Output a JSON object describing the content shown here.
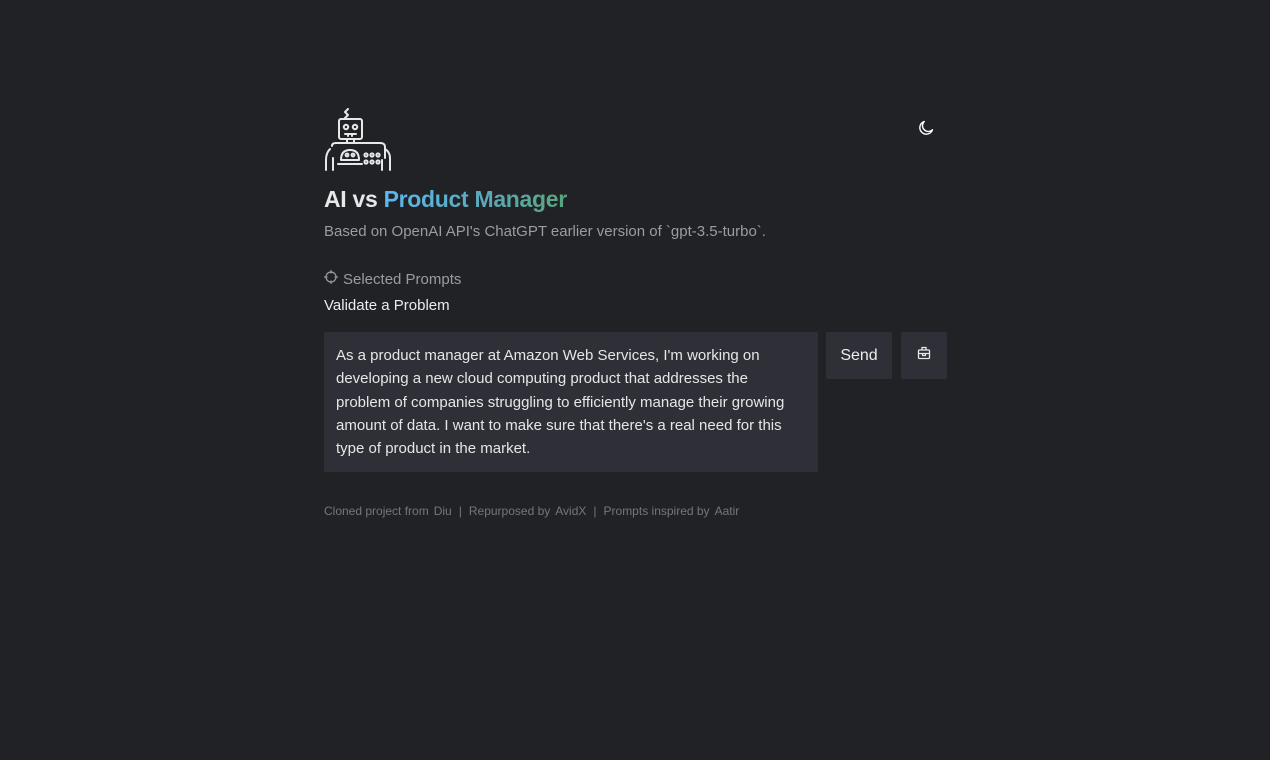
{
  "header": {
    "logo_icon": "robot-icon",
    "theme_toggle_icon": "moon-icon",
    "title_plain": "AI vs ",
    "title_highlight": "Product Manager",
    "subtitle": "Based on OpenAI API's ChatGPT earlier version of `gpt-3.5-turbo`."
  },
  "prompts": {
    "header_icon": "target-icon",
    "header_label": "Selected Prompts",
    "selected": "Validate a Problem"
  },
  "input": {
    "value": "As a product manager at Amazon Web Services, I'm working on developing a new cloud computing product that addresses the problem of companies struggling to efficiently manage their growing amount of data. I want to make sure that there's a real need for this type of product in the market."
  },
  "actions": {
    "send_label": "Send",
    "clear_icon": "basket-icon"
  },
  "footer": {
    "cloned_text": "Cloned project from",
    "cloned_link": "Diu",
    "sep1": "|",
    "repurposed_text": "Repurposed by",
    "repurposed_link": "AvidX",
    "sep2": "|",
    "inspired_text": "Prompts inspired by",
    "inspired_link": "Aatir"
  },
  "colors": {
    "background": "#212226",
    "panel": "#2f3037",
    "gradient_start": "#5db8f0",
    "gradient_end": "#58a67c"
  }
}
